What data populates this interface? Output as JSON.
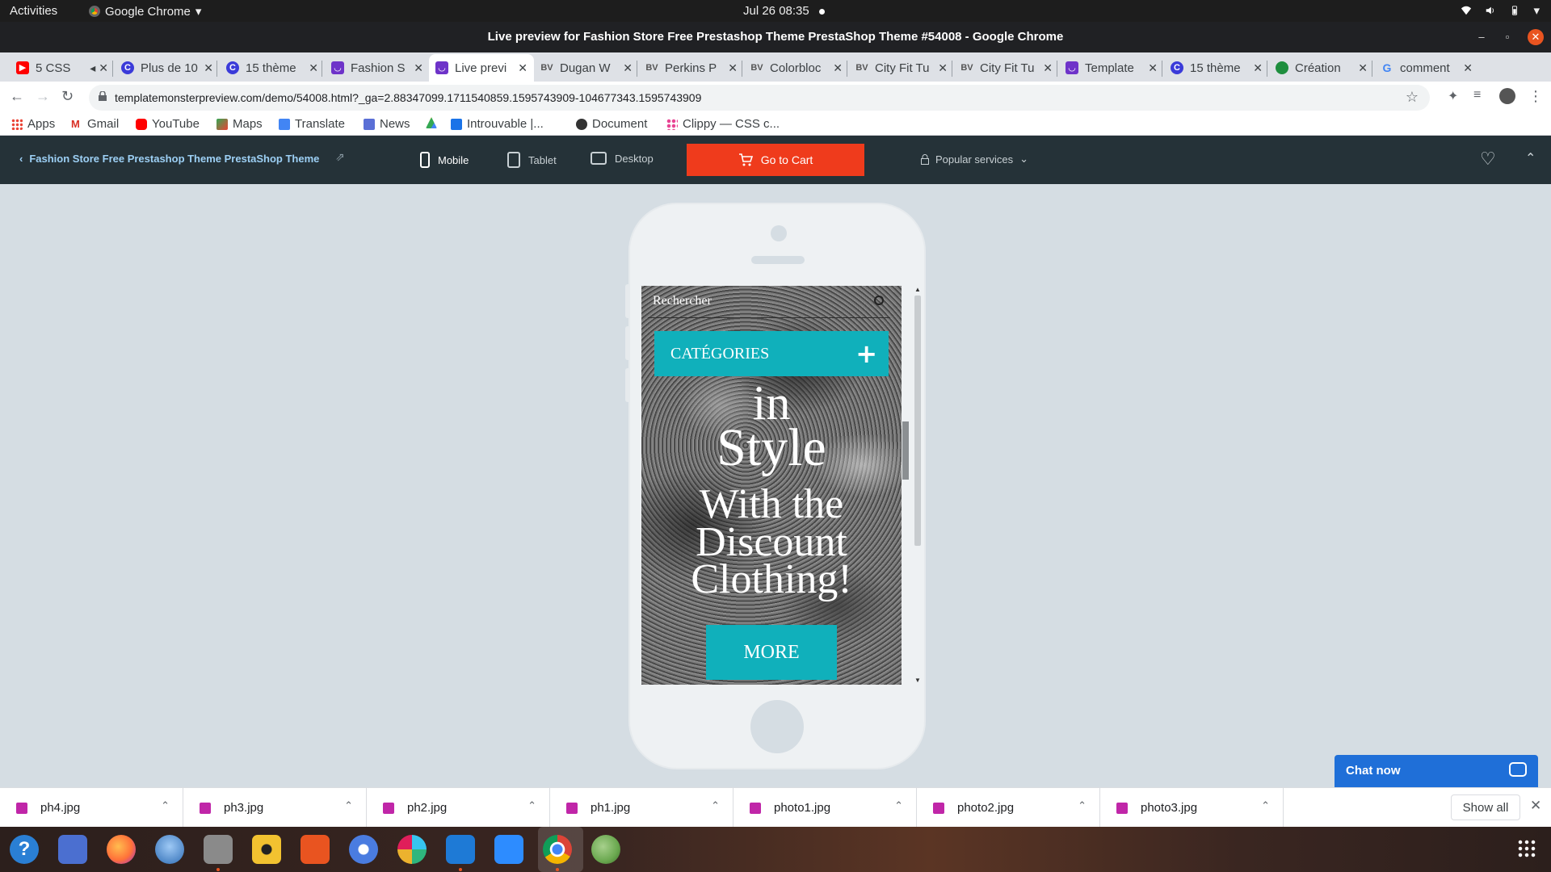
{
  "topbar": {
    "activities": "Activities",
    "app_name": "Google Chrome",
    "datetime": "Jul 26  08:35"
  },
  "window": {
    "title": "Live preview for Fashion Store Free Prestashop Theme PrestaShop Theme #54008 - Google Chrome"
  },
  "tabs": [
    {
      "label": "5 CSS",
      "favicon_color": "#ff0000",
      "favicon": "youtube-icon"
    },
    {
      "label": "Plus de 10",
      "favicon_color": "#3b3bd9",
      "favicon": "c-icon"
    },
    {
      "label": "15 thème",
      "favicon_color": "#3b3bd9",
      "favicon": "c-icon"
    },
    {
      "label": "Fashion S",
      "favicon_color": "#6e33c9",
      "favicon": "templatemonster-icon"
    },
    {
      "label": "Live previ",
      "favicon_color": "#6e33c9",
      "favicon": "templatemonster-icon"
    },
    {
      "label": "Dugan W",
      "favicon_color": "#666666",
      "favicon": "bv-icon"
    },
    {
      "label": "Perkins P",
      "favicon_color": "#666666",
      "favicon": "bv-icon"
    },
    {
      "label": "Colorbloc",
      "favicon_color": "#666666",
      "favicon": "bv-icon"
    },
    {
      "label": "City Fit Tu",
      "favicon_color": "#666666",
      "favicon": "bv-icon"
    },
    {
      "label": "City Fit Tu",
      "favicon_color": "#666666",
      "favicon": "bv-icon"
    },
    {
      "label": "Template",
      "favicon_color": "#6e33c9",
      "favicon": "templatemonster-icon"
    },
    {
      "label": "15 thème",
      "favicon_color": "#3b3bd9",
      "favicon": "c-icon"
    },
    {
      "label": "Création",
      "favicon_color": "#1e8e3e",
      "favicon": "globe-icon"
    },
    {
      "label": "comment",
      "favicon_color": "#4285f4",
      "favicon": "google-icon"
    }
  ],
  "url": "templatemonsterpreview.com/demo/54008.html?_ga=2.88347099.1711540859.1595743909-104677343.1595743909",
  "bookmarks": [
    {
      "label": "Apps",
      "color": "#ea4335"
    },
    {
      "label": "Gmail",
      "color": "#d93025"
    },
    {
      "label": "YouTube",
      "color": "#ff0000"
    },
    {
      "label": "Maps",
      "color": "#34a853"
    },
    {
      "label": "Translate",
      "color": "#4285f4"
    },
    {
      "label": "News",
      "color": "#5a6fd6"
    },
    {
      "label": "",
      "color": "#fbbc04"
    },
    {
      "label": "Introuvable |...",
      "color": "#1a73e8"
    },
    {
      "label": "Document",
      "color": "#333333"
    },
    {
      "label": "Clippy — CSS c...",
      "color": "#e84393"
    }
  ],
  "tm_header": {
    "back_title": "Fashion Store Free Prestashop Theme PrestaShop Theme",
    "devices": [
      "Mobile",
      "Tablet",
      "Desktop"
    ],
    "go_to_cart": "Go to Cart",
    "popular_services": "Popular services",
    "accent": "#ef3b1c"
  },
  "preview": {
    "search_placeholder": "Rechercher",
    "categories": "CATÉGORIES",
    "hero_lines": [
      "in",
      "Style",
      "With the",
      "Discount",
      "Clothing!"
    ],
    "more": "MORE",
    "accent": "#10b0bb"
  },
  "chat": {
    "label": "Chat now"
  },
  "downloads": {
    "files": [
      "ph4.jpg",
      "ph3.jpg",
      "ph2.jpg",
      "ph1.jpg",
      "photo1.jpg",
      "photo2.jpg",
      "photo3.jpg"
    ],
    "show_all": "Show all"
  },
  "dock": [
    {
      "name": "help-icon",
      "color": "#2a7fd4"
    },
    {
      "name": "translate-app-icon",
      "color": "#4b6fd0"
    },
    {
      "name": "firefox-icon",
      "color": "#ff7139"
    },
    {
      "name": "thunderbird-icon",
      "color": "#2f6db5"
    },
    {
      "name": "files-icon",
      "color": "#8a8a8a"
    },
    {
      "name": "rhythmbox-icon",
      "color": "#f2c230"
    },
    {
      "name": "software-icon",
      "color": "#e95420"
    },
    {
      "name": "chromium-icon",
      "color": "#4a7ce0"
    },
    {
      "name": "slack-icon",
      "color": "#4a154b"
    },
    {
      "name": "vscode-icon",
      "color": "#1e7ad6"
    },
    {
      "name": "zoom-icon",
      "color": "#2d8cff"
    },
    {
      "name": "chrome-icon",
      "color": "#34a853"
    },
    {
      "name": "maps-app-icon",
      "color": "#6aa84f"
    }
  ]
}
